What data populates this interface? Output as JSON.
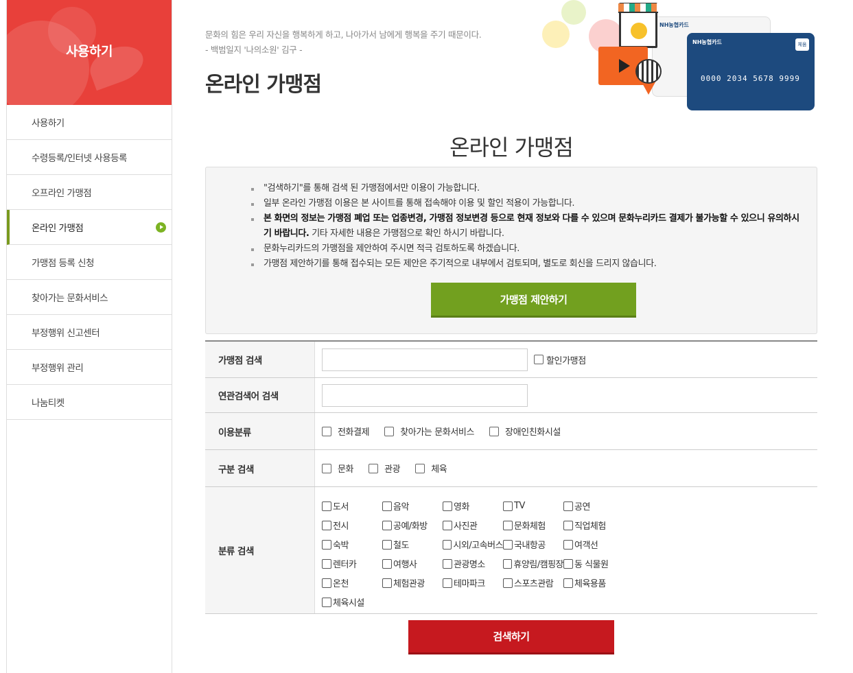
{
  "sidebar": {
    "hero_title": "사용하기",
    "items": [
      {
        "label": "사용하기"
      },
      {
        "label": "수령등록/인터넷 사용등록"
      },
      {
        "label": "오프라인 가맹점"
      },
      {
        "label": "온라인 가맹점"
      },
      {
        "label": "가맹점 등록 신청"
      },
      {
        "label": "찾아가는 문화서비스"
      },
      {
        "label": "부정행위 신고센터"
      },
      {
        "label": "부정행위 관리"
      },
      {
        "label": "나눔티켓"
      }
    ],
    "active_index": 3
  },
  "header": {
    "quote_line1": "문화의 힘은 우리 자신을 행복하게 하고, 나아가서 남에게 행복을 주기 때문이다.",
    "quote_line2": "- 백범일지 '나의소원' 김구 -",
    "page_title": "온라인 가맹점"
  },
  "illustration": {
    "card_front_brand": "NH농협카드",
    "card_back_brand": "NH농협카드",
    "card_badge": "체움",
    "card_number": "0000 2034 5678 9999"
  },
  "section_title": "온라인 가맹점",
  "notice": {
    "items": [
      {
        "text": "\"검색하기\"를 통해 검색 된 가맹점에서만 이용이 가능합니다."
      },
      {
        "text": "일부 온라인 가맹점 이용은 본 사이트를 통해 접속해야 이용 및 할인 적용이 가능합니다."
      },
      {
        "bold": "본 화면의 정보는 가맹점 폐업 또는 업종변경, 가맹점 정보변경 등으로 현재 정보와 다를 수 있으며 문화누리카드 결제가 불가능할 수 있으니 유의하시기 바랍니다.",
        "text": " 기타 자세한 내용은 가맹점으로 확인 하시기 바랍니다."
      },
      {
        "text": "문화누리카드의 가맹점을 제안하여 주시면 적극 검토하도록 하겠습니다."
      },
      {
        "text": "가맹점 제안하기를 통해 접수되는 모든 제안은 주기적으로 내부에서 검토되며, 별도로 회신을 드리지 않습니다."
      }
    ],
    "suggest_button": "가맹점 제안하기"
  },
  "form": {
    "store_search": {
      "label": "가맹점 검색",
      "value": "",
      "placeholder": "",
      "discount_label": "할인가맹점"
    },
    "related_search": {
      "label": "연관검색어 검색",
      "value": "",
      "placeholder": ""
    },
    "usage_category": {
      "label": "이용분류",
      "options": [
        "전화결제",
        "찾아가는 문화서비스",
        "장애인친화시설"
      ]
    },
    "division_search": {
      "label": "구분 검색",
      "options": [
        "문화",
        "관광",
        "체육"
      ]
    },
    "category_search": {
      "label": "분류 검색",
      "options": [
        "도서",
        "음악",
        "영화",
        "TV",
        "공연",
        "전시",
        "공예/화방",
        "사진관",
        "문화체험",
        "직업체험",
        "숙박",
        "철도",
        "시외/고속버스",
        "국내항공",
        "여객선",
        "렌터카",
        "여행사",
        "관광명소",
        "휴양림/캠핑장",
        "동 식물원",
        "온천",
        "체험관광",
        "테마파크",
        "스포츠관람",
        "체육용품",
        "체육시설"
      ]
    }
  },
  "search_button": "검색하기",
  "colors": {
    "hero_red": "#e8403a",
    "accent_green": "#72a01f",
    "search_red": "#c6191f"
  }
}
